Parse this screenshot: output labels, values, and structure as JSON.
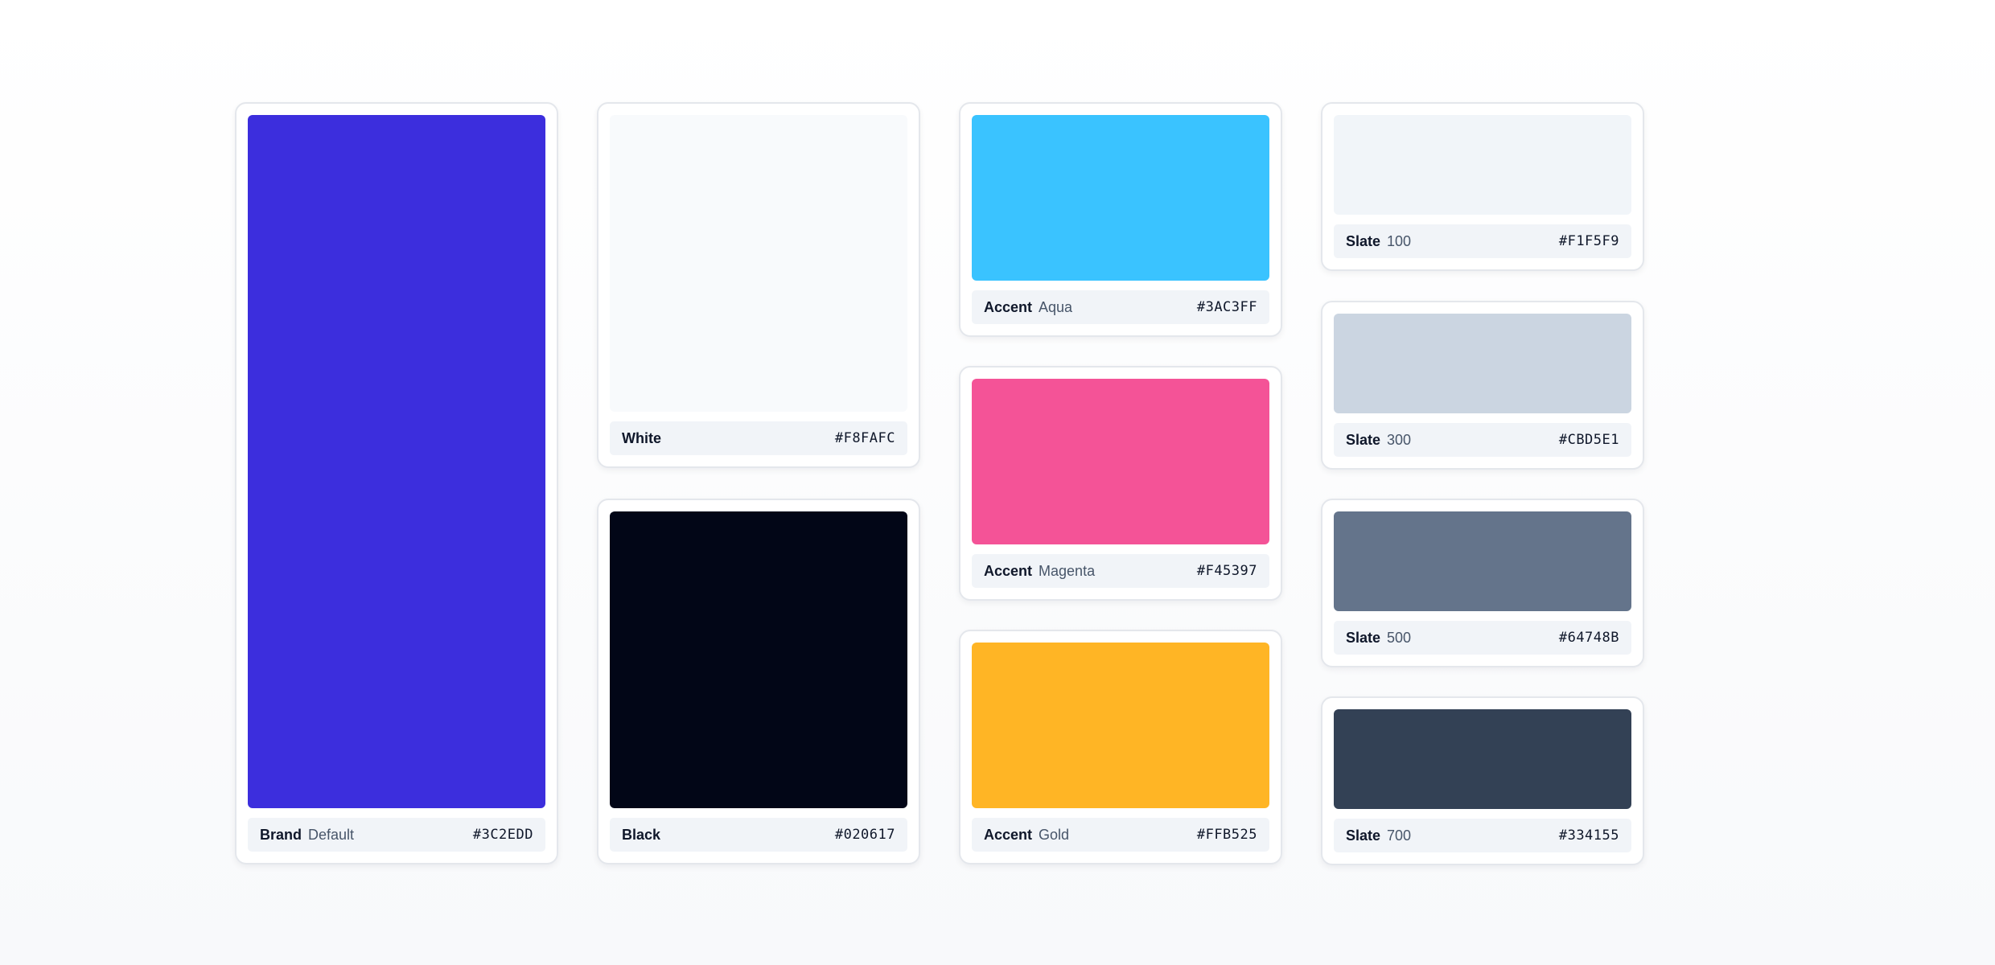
{
  "swatches": [
    {
      "name": "Brand",
      "variant": "Default",
      "hex": "#3C2EDD",
      "color": "#3C2EDD"
    },
    {
      "name": "White",
      "variant": "",
      "hex": "#F8FAFC",
      "color": "#F8FAFC"
    },
    {
      "name": "Black",
      "variant": "",
      "hex": "#020617",
      "color": "#020617"
    },
    {
      "name": "Accent",
      "variant": "Aqua",
      "hex": "#3AC3FF",
      "color": "#3AC3FF"
    },
    {
      "name": "Accent",
      "variant": "Magenta",
      "hex": "#F45397",
      "color": "#F45397"
    },
    {
      "name": "Accent",
      "variant": "Gold",
      "hex": "#FFB525",
      "color": "#FFB525"
    },
    {
      "name": "Slate",
      "variant": "100",
      "hex": "#F1F5F9",
      "color": "#F1F5F9"
    },
    {
      "name": "Slate",
      "variant": "300",
      "hex": "#CBD5E1",
      "color": "#CBD5E1"
    },
    {
      "name": "Slate",
      "variant": "500",
      "hex": "#64748B",
      "color": "#64748B"
    },
    {
      "name": "Slate",
      "variant": "700",
      "hex": "#334155",
      "color": "#334155"
    }
  ]
}
